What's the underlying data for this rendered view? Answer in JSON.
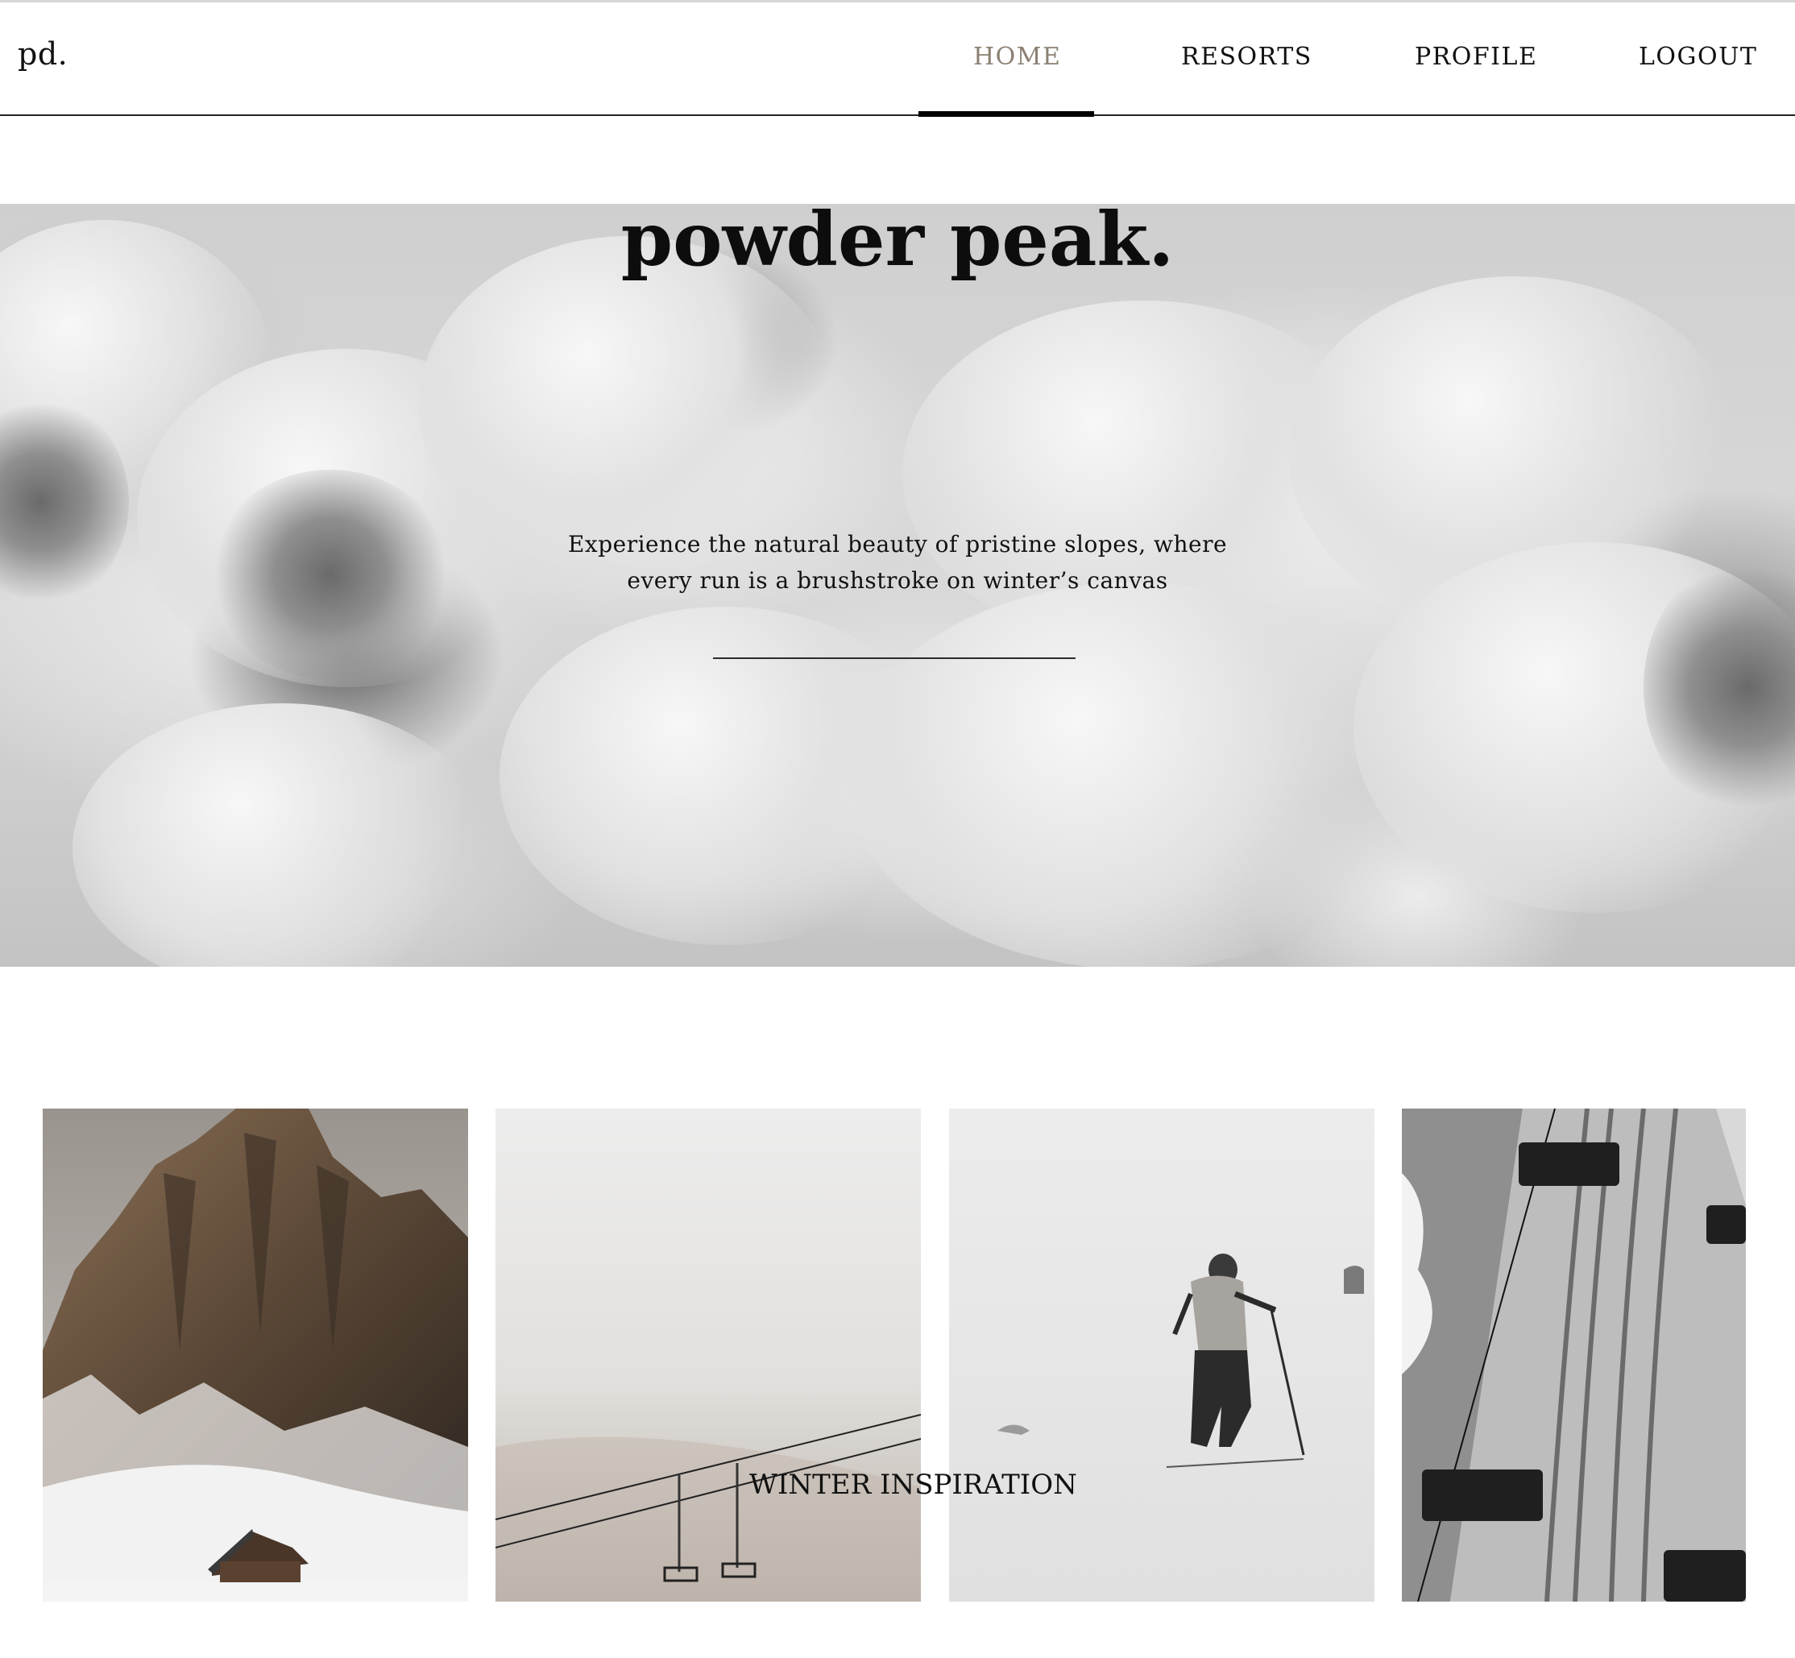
{
  "nav": {
    "logo": "pd.",
    "items": [
      {
        "label": "HOME",
        "active": true
      },
      {
        "label": "RESORTS",
        "active": false
      },
      {
        "label": "PROFILE",
        "active": false
      },
      {
        "label": "LOGOUT",
        "active": false
      }
    ]
  },
  "hero": {
    "title": "powder peak.",
    "subtitle_line1": "Experience the natural beauty of pristine slopes, where",
    "subtitle_line2": "every run is a brushstroke on winter’s canvas"
  },
  "gallery": {
    "caption": "WINTER INSPIRATION",
    "images": [
      {
        "subject": "snowy-mountain-with-cabin"
      },
      {
        "subject": "chairlift-in-fog"
      },
      {
        "subject": "backcountry-skier"
      },
      {
        "subject": "aerial-chairlift-over-slope"
      }
    ]
  },
  "colors": {
    "active_nav": "#8a7f72",
    "text": "#111111",
    "accent_underline": "#000000"
  }
}
